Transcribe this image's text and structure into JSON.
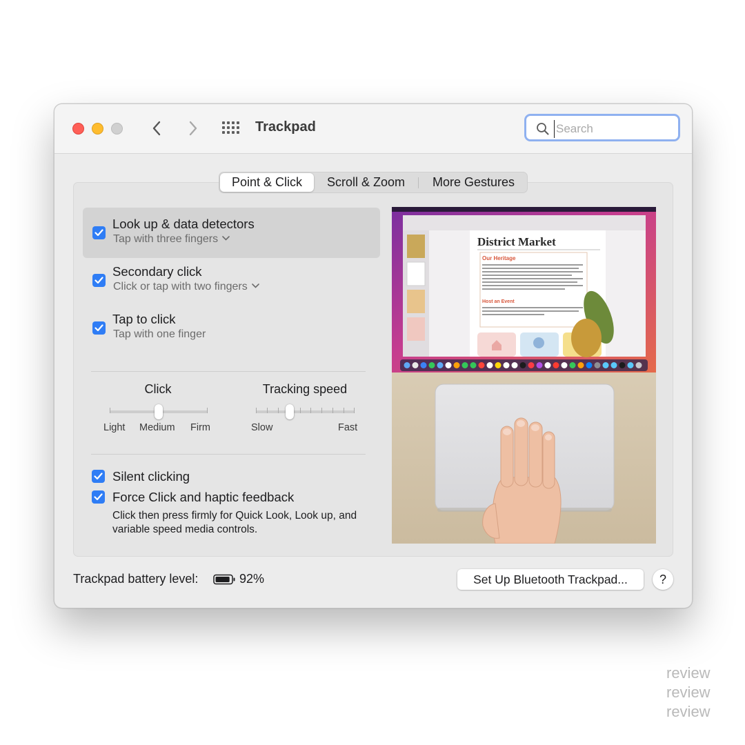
{
  "window": {
    "title": "Trackpad",
    "search_placeholder": "Search"
  },
  "tabs": [
    {
      "label": "Point & Click",
      "active": true
    },
    {
      "label": "Scroll & Zoom",
      "active": false
    },
    {
      "label": "More Gestures",
      "active": false
    }
  ],
  "options": [
    {
      "label": "Look up & data detectors",
      "sub": "Tap with three fingers",
      "has_menu": true,
      "checked": true,
      "selected": true
    },
    {
      "label": "Secondary click",
      "sub": "Click or tap with two fingers",
      "has_menu": true,
      "checked": true,
      "selected": false
    },
    {
      "label": "Tap to click",
      "sub": "Tap with one finger",
      "has_menu": false,
      "checked": true,
      "selected": false
    }
  ],
  "click_slider": {
    "title": "Click",
    "labels": [
      "Light",
      "Medium",
      "Firm"
    ],
    "value_label": "Medium"
  },
  "tracking_slider": {
    "title": "Tracking speed",
    "min_label": "Slow",
    "max_label": "Fast",
    "level_fraction": 0.35
  },
  "silent_clicking": {
    "label": "Silent clicking",
    "checked": true
  },
  "force_click": {
    "label": "Force Click and haptic feedback",
    "checked": true,
    "description": "Click then press firmly for Quick Look, Look up, and variable speed media controls."
  },
  "preview": {
    "doc_title": "District Market",
    "heading1": "Our Heritage",
    "heading2": "Host an Event"
  },
  "footer": {
    "battery_label": "Trackpad battery level:",
    "battery_percent": "92%",
    "battery_level": 0.92,
    "setup_button": "Set Up Bluetooth Trackpad...",
    "help_button": "?"
  },
  "watermark": [
    "review",
    "review",
    "review"
  ],
  "colors": {
    "accent": "#2f7df5",
    "search_focus": "#8fb1f0",
    "close": "#fe5f57",
    "minimize": "#febc2e"
  }
}
